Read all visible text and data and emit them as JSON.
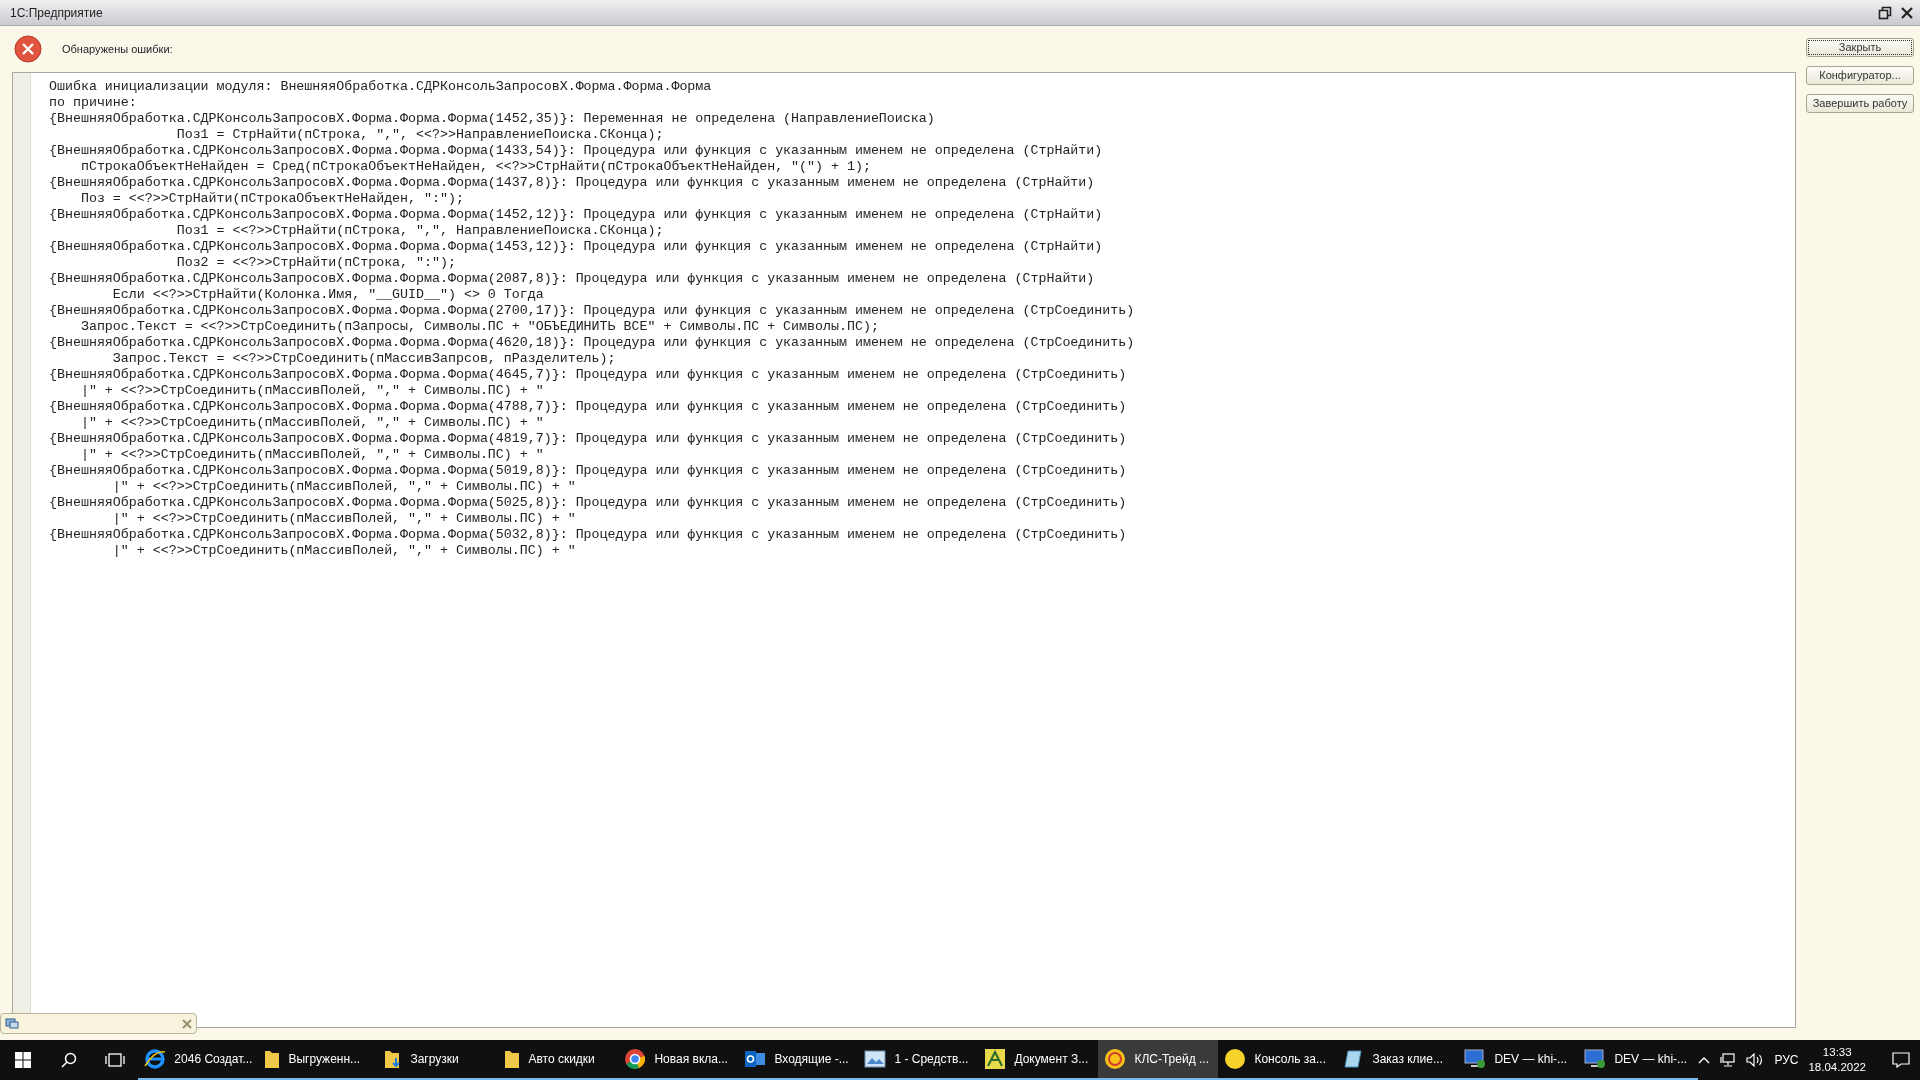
{
  "window": {
    "title": "1С:Предприятие"
  },
  "header": {
    "message": "Обнаружены ошибки:"
  },
  "buttons": [
    {
      "label": "Закрыть",
      "focused": true
    },
    {
      "label": "Конфигуратор...",
      "focused": false
    },
    {
      "label": "Завершить работу",
      "focused": false
    }
  ],
  "error_lines": [
    "Ошибка инициализации модуля: ВнешняяОбработка.СДРКонсольЗапросовХ.Форма.Форма.Форма",
    "по причине:",
    "{ВнешняяОбработка.СДРКонсольЗапросовХ.Форма.Форма.Форма(1452,35)}: Переменная не определена (НаправлениеПоиска)",
    "                Поз1 = СтрНайти(пСтрока, \",\", <<?>>НаправлениеПоиска.СКонца);",
    "{ВнешняяОбработка.СДРКонсольЗапросовХ.Форма.Форма.Форма(1433,54)}: Процедура или функция с указанным именем не определена (СтрНайти)",
    "    пСтрокаОбъектНеНайден = Сред(пСтрокаОбъектНеНайден, <<?>>СтрНайти(пСтрокаОбъектНеНайден, \"(\") + 1);",
    "{ВнешняяОбработка.СДРКонсольЗапросовХ.Форма.Форма.Форма(1437,8)}: Процедура или функция с указанным именем не определена (СтрНайти)",
    "    Поз = <<?>>СтрНайти(пСтрокаОбъектНеНайден, \":\");",
    "{ВнешняяОбработка.СДРКонсольЗапросовХ.Форма.Форма.Форма(1452,12)}: Процедура или функция с указанным именем не определена (СтрНайти)",
    "                Поз1 = <<?>>СтрНайти(пСтрока, \",\", НаправлениеПоиска.СКонца);",
    "{ВнешняяОбработка.СДРКонсольЗапросовХ.Форма.Форма.Форма(1453,12)}: Процедура или функция с указанным именем не определена (СтрНайти)",
    "                Поз2 = <<?>>СтрНайти(пСтрока, \":\");",
    "{ВнешняяОбработка.СДРКонсольЗапросовХ.Форма.Форма.Форма(2087,8)}: Процедура или функция с указанным именем не определена (СтрНайти)",
    "        Если <<?>>СтрНайти(Колонка.Имя, \"__GUID__\") <> 0 Тогда",
    "{ВнешняяОбработка.СДРКонсольЗапросовХ.Форма.Форма.Форма(2700,17)}: Процедура или функция с указанным именем не определена (СтрСоединить)",
    "    Запрос.Текст = <<?>>СтрСоединить(пЗапросы, Символы.ПС + \"ОБЪЕДИНИТЬ ВСЕ\" + Символы.ПС + Символы.ПС);",
    "{ВнешняяОбработка.СДРКонсольЗапросовХ.Форма.Форма.Форма(4620,18)}: Процедура или функция с указанным именем не определена (СтрСоединить)",
    "        Запрос.Текст = <<?>>СтрСоединить(пМассивЗапрсов, пРазделитель);",
    "{ВнешняяОбработка.СДРКонсольЗапросовХ.Форма.Форма.Форма(4645,7)}: Процедура или функция с указанным именем не определена (СтрСоединить)",
    "    |\" + <<?>>СтрСоединить(пМассивПолей, \",\" + Символы.ПС) + \"",
    "{ВнешняяОбработка.СДРКонсольЗапросовХ.Форма.Форма.Форма(4788,7)}: Процедура или функция с указанным именем не определена (СтрСоединить)",
    "    |\" + <<?>>СтрСоединить(пМассивПолей, \",\" + Символы.ПС) + \"",
    "{ВнешняяОбработка.СДРКонсольЗапросовХ.Форма.Форма.Форма(4819,7)}: Процедура или функция с указанным именем не определена (СтрСоединить)",
    "    |\" + <<?>>СтрСоединить(пМассивПолей, \",\" + Символы.ПС) + \"",
    "{ВнешняяОбработка.СДРКонсольЗапросовХ.Форма.Форма.Форма(5019,8)}: Процедура или функция с указанным именем не определена (СтрСоединить)",
    "        |\" + <<?>>СтрСоединить(пМассивПолей, \",\" + Символы.ПС) + \"",
    "{ВнешняяОбработка.СДРКонсольЗапросовХ.Форма.Форма.Форма(5025,8)}: Процедура или функция с указанным именем не определена (СтрСоединить)",
    "        |\" + <<?>>СтрСоединить(пМассивПолей, \",\" + Символы.ПС) + \"",
    "{ВнешняяОбработка.СДРКонсольЗапросовХ.Форма.Форма.Форма(5032,8)}: Процедура или функция с указанным именем не определена (СтрСоединить)",
    "        |\" + <<?>>СтрСоединить(пМассивПолей, \",\" + Символы.ПС) + \""
  ],
  "taskbar": {
    "apps": [
      {
        "label": "2046 Создат...",
        "selected": false
      },
      {
        "label": "Выгруженн...",
        "selected": false
      },
      {
        "label": "Загрузки",
        "selected": false
      },
      {
        "label": "Авто скидки",
        "selected": false
      },
      {
        "label": "Новая вкла...",
        "selected": false
      },
      {
        "label": "Входящие -...",
        "selected": false
      },
      {
        "label": "1 - Средств...",
        "selected": false
      },
      {
        "label": "Документ З...",
        "selected": false
      },
      {
        "label": "КЛС-Трейд ...",
        "selected": true
      },
      {
        "label": "Консоль за...",
        "selected": false
      },
      {
        "label": "Заказ клие...",
        "selected": false
      },
      {
        "label": "DEV — khi-...",
        "selected": false
      },
      {
        "label": "DEV — khi-...",
        "selected": false
      }
    ],
    "language": "РУС",
    "time": "13:33",
    "date": "18.04.2022"
  }
}
